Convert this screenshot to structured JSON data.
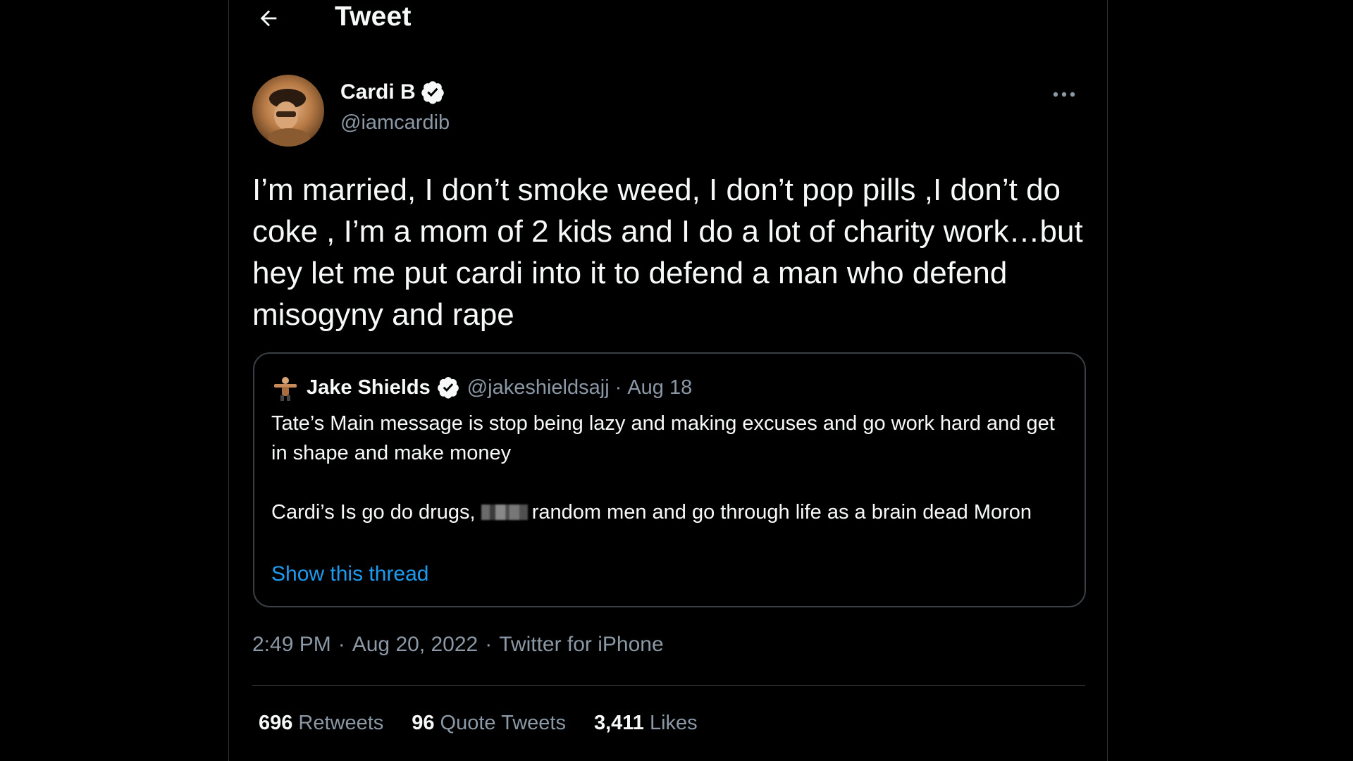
{
  "header": {
    "title": "Tweet",
    "back_icon": "arrow-left-icon"
  },
  "tweet": {
    "author": {
      "name": "Cardi B",
      "handle": "@iamcardib",
      "verified": true
    },
    "more_icon": "more-horizontal-icon",
    "text": "I’m married, I don’t smoke weed, I don’t pop pills ,I don’t do coke , I’m a mom of 2 kids and I do a lot of charity work…but hey let me put cardi into it to defend a man who defend misogyny and rape",
    "quoted": {
      "author_name": "Jake Shields",
      "handle": "@jakeshieldsajj",
      "separator": "·",
      "date": "Aug 18",
      "verified": true,
      "paragraph1": "Tate’s Main message is stop being lazy and making excuses and go work hard and get in shape and make money",
      "paragraph2_before": "Cardi’s Is go do drugs,",
      "paragraph2_after": "random men and go through life as a brain dead Moron",
      "show_thread": "Show this thread"
    },
    "meta": {
      "time": "2:49 PM",
      "separator": "·",
      "date": "Aug 20, 2022",
      "source": "Twitter for iPhone"
    },
    "stats": {
      "retweets_count": "696",
      "retweets_label": "Retweets",
      "quotes_count": "96",
      "quotes_label": "Quote Tweets",
      "likes_count": "3,411",
      "likes_label": "Likes"
    }
  },
  "colors": {
    "background": "#000000",
    "text_primary": "#f7f9f9",
    "text_secondary": "#8b98a5",
    "accent": "#1d9bf0",
    "border": "#3a3f44"
  }
}
